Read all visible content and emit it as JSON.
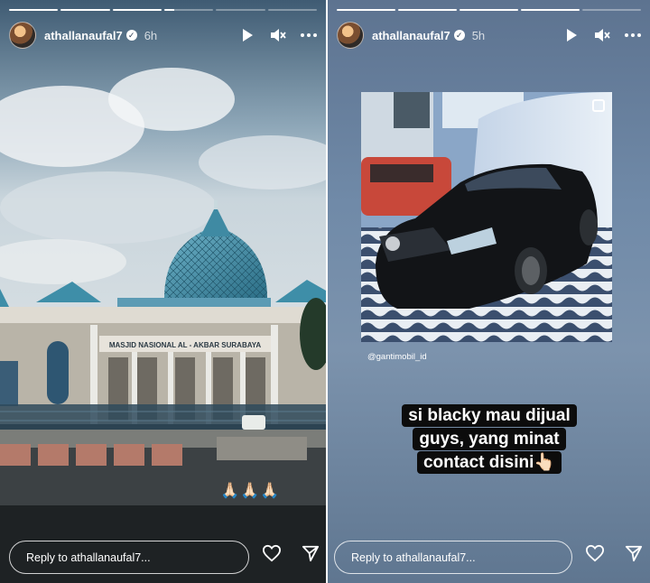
{
  "stories": [
    {
      "username": "athallanaufal7",
      "time": "6h",
      "progress": [
        1,
        1,
        1,
        0.2,
        0,
        0
      ],
      "photo_sign": "MASJID NASIONAL AL - AKBAR SURABAYA",
      "emoji": "🙏🏻🙏🏻🙏🏻",
      "reply_placeholder": "Reply to athallanaufal7..."
    },
    {
      "username": "athallanaufal7",
      "time": "5h",
      "progress": [
        1,
        1,
        1,
        1,
        0
      ],
      "post_handle": "@gantimobil_id",
      "caption": "si blacky mau dijual guys, yang minat contact disini👆🏻",
      "reply_placeholder": "Reply to athallanaufal7..."
    }
  ],
  "icons": [
    "play-icon",
    "mute-icon",
    "more-icon",
    "heart-icon",
    "send-icon",
    "verified-icon",
    "carousel-icon"
  ]
}
